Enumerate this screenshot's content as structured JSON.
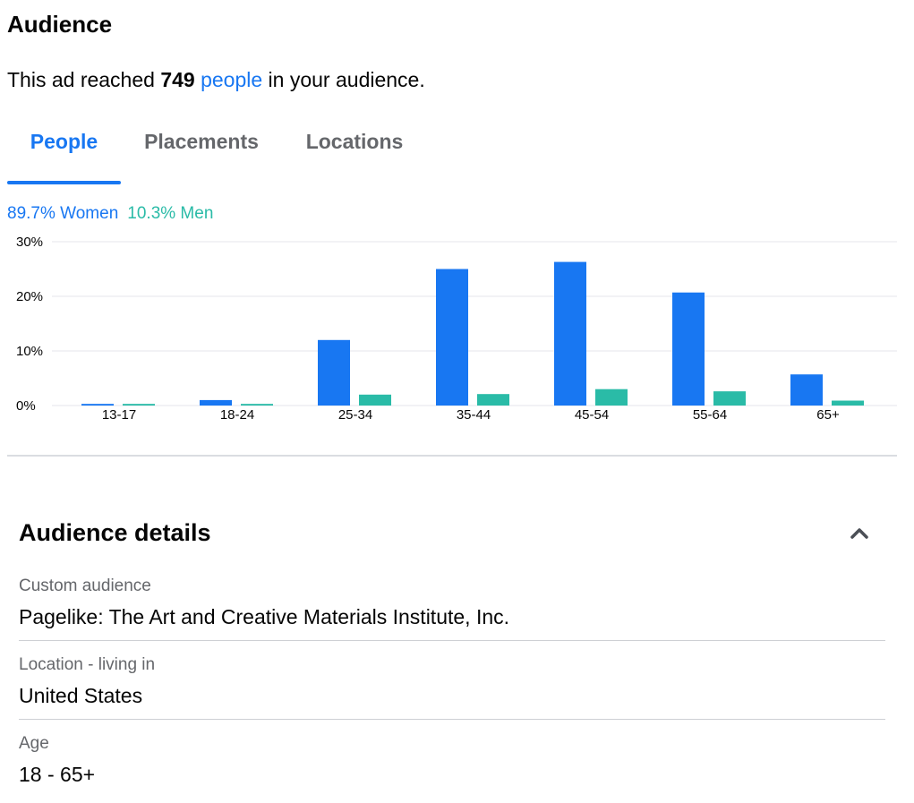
{
  "header": {
    "title": "Audience",
    "summary_prefix": "This ad reached ",
    "summary_count": "749",
    "summary_link": "people",
    "summary_suffix": " in your audience."
  },
  "tabs": [
    {
      "label": "People",
      "active": true
    },
    {
      "label": "Placements",
      "active": false
    },
    {
      "label": "Locations",
      "active": false
    }
  ],
  "gender_split": {
    "women": "89.7% Women",
    "men": "10.3% Men"
  },
  "colors": {
    "accent": "#1877f2",
    "women": "#1877f2",
    "men": "#2abba7",
    "muted_text": "#65676b"
  },
  "chart_data": {
    "type": "bar",
    "categories": [
      "13-17",
      "18-24",
      "25-34",
      "35-44",
      "45-54",
      "55-64",
      "65+"
    ],
    "series": [
      {
        "name": "Women",
        "values": [
          0.3,
          1.0,
          12.0,
          25.0,
          26.3,
          20.7,
          5.7
        ]
      },
      {
        "name": "Men",
        "values": [
          0.3,
          0.3,
          2.0,
          2.1,
          3.0,
          2.6,
          0.9
        ]
      }
    ],
    "ylim": [
      0,
      30
    ],
    "yticks": [
      "0%",
      "10%",
      "20%",
      "30%"
    ],
    "ytick_values": [
      0,
      10,
      20,
      30
    ],
    "grid": true
  },
  "details": {
    "title": "Audience details",
    "collapse_icon": "chevron-up-icon",
    "items": [
      {
        "label": "Custom audience",
        "value": "Pagelike: The Art and Creative Materials Institute, Inc."
      },
      {
        "label": "Location - living in",
        "value": "United States"
      },
      {
        "label": "Age",
        "value": "18 - 65+"
      }
    ]
  }
}
